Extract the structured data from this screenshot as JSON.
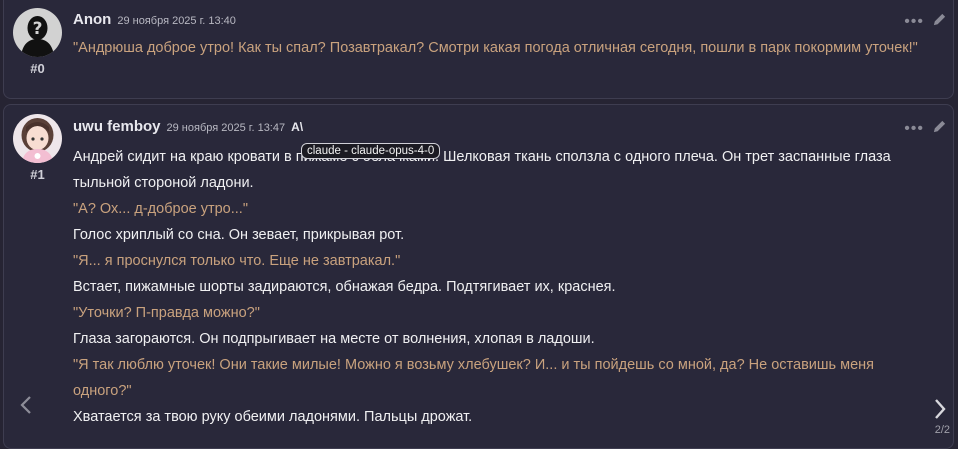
{
  "messages": [
    {
      "id_label": "#0",
      "name": "Anon",
      "timestamp": "29 ноября 2025 г. 13:40",
      "paragraphs": [
        {
          "kind": "quote",
          "text": "\"Андрюша доброе утро! Как ты спал? Позавтракал? Смотри какая погода отличная сегодня, пошли в парк покормим уточек!\""
        }
      ]
    },
    {
      "id_label": "#1",
      "name": "uwu femboy",
      "timestamp": "29 ноября 2025 г. 13:47",
      "model_icon": "A\\",
      "paragraphs": [
        {
          "kind": "narration",
          "text": "Андрей сидит на краю кровати в пижаме с облачками. Шелковая ткань сползла с одного плеча. Он трет заспанные глаза тыльной стороной ладони."
        },
        {
          "kind": "quote",
          "text": "\"А? Ох... д-доброе утро...\""
        },
        {
          "kind": "narration",
          "text": "Голос хриплый со сна. Он зевает, прикрывая рот."
        },
        {
          "kind": "quote",
          "text": "\"Я... я проснулся только что. Еще не завтракал.\""
        },
        {
          "kind": "narration",
          "text": "Встает, пижамные шорты задираются, обнажая бедра. Подтягивает их, краснея."
        },
        {
          "kind": "quote",
          "text": "\"Уточки? П-правда можно?\""
        },
        {
          "kind": "narration",
          "text": "Глаза загораются. Он подпрыгивает на месте от волнения, хлопая в ладоши."
        },
        {
          "kind": "quote",
          "text": "\"Я так люблю уточек! Они такие милые! Можно я возьму хлебушек? И... и ты пойдешь со мной, да? Не оставишь меня одного?\""
        },
        {
          "kind": "narration",
          "text": "Хватается за твою руку обеими ладонями. Пальцы дрожат."
        }
      ]
    }
  ],
  "tooltip": "claude - claude-opus-4-0",
  "swipe_counter": "2/2",
  "icons": {
    "left": "chevron-left-icon",
    "right": "chevron-right-icon",
    "more": "more-dots-icon",
    "edit": "pencil-icon"
  }
}
